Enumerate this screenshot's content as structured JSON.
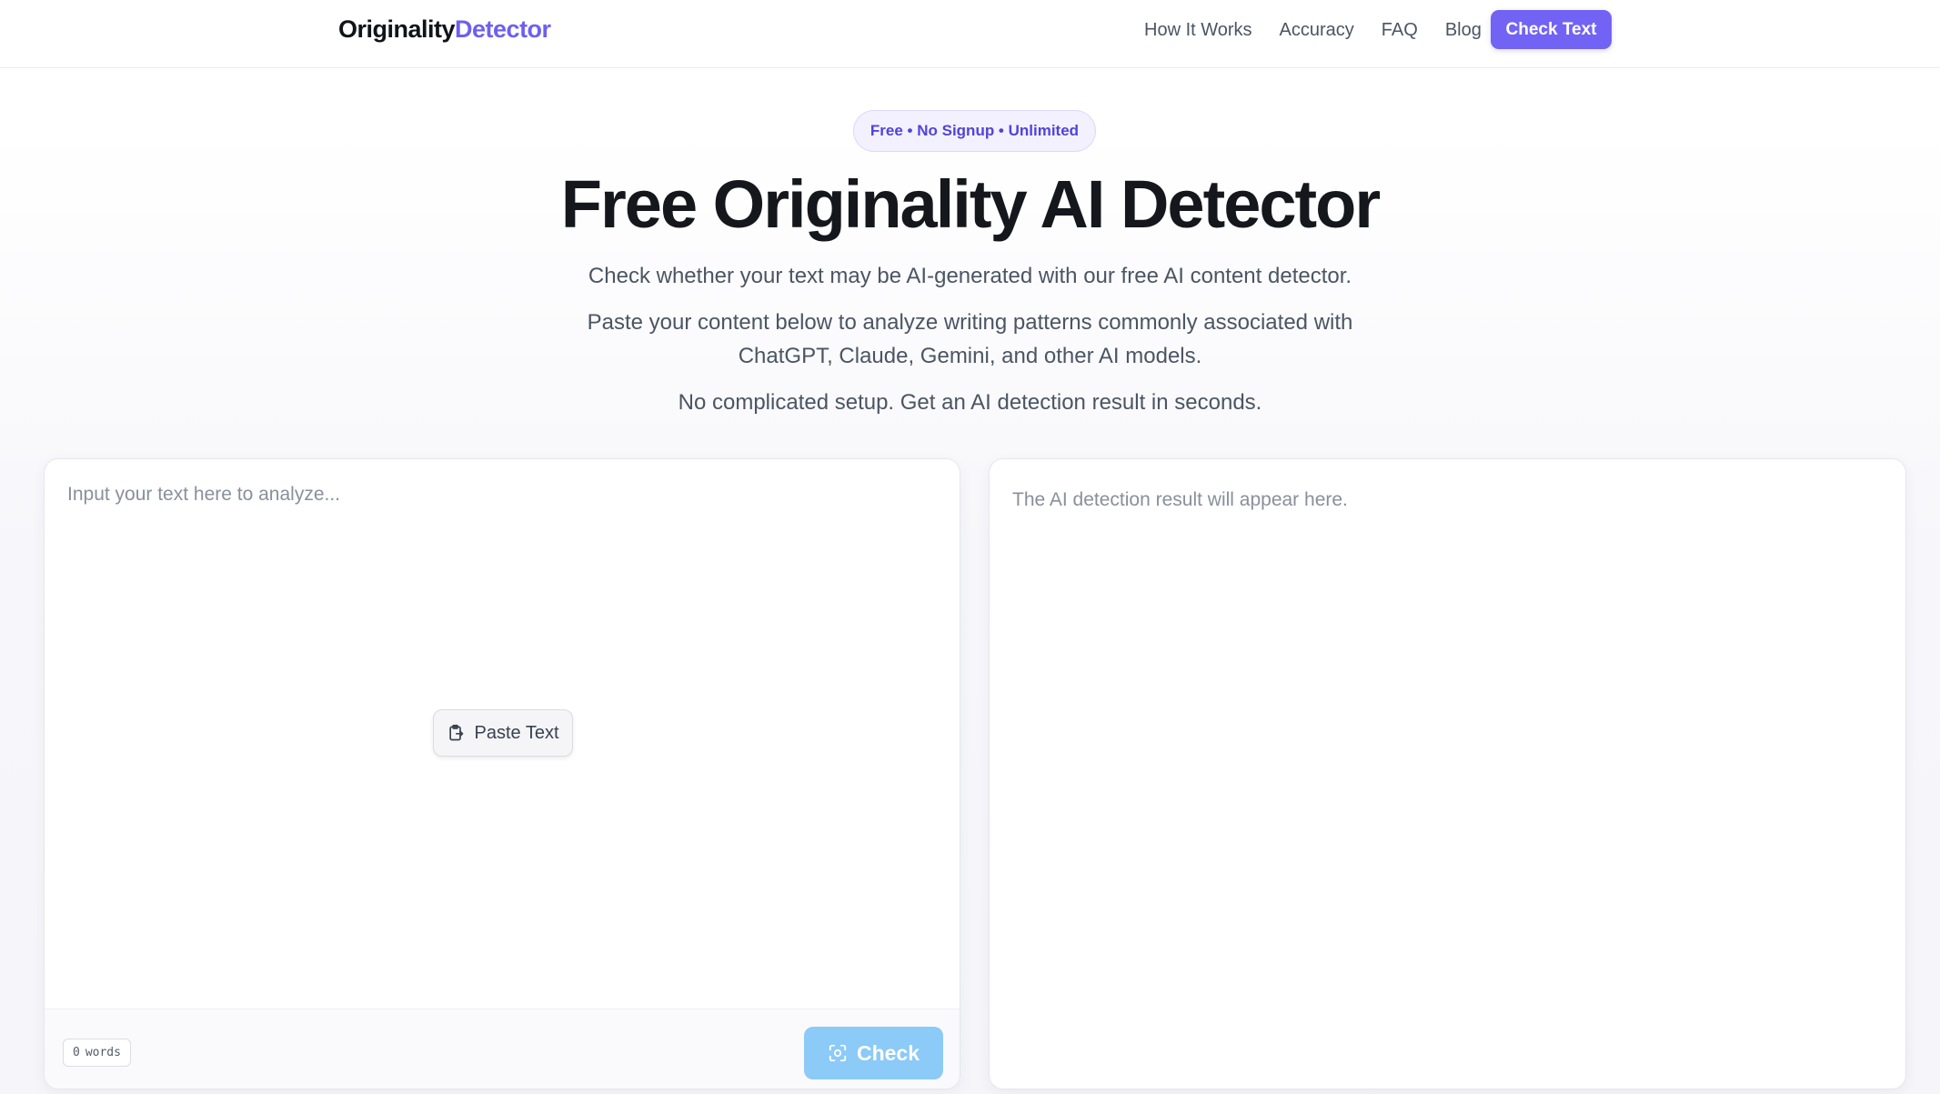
{
  "header": {
    "logo_part1": "Originality",
    "logo_part2": "Detector",
    "nav": [
      "How It Works",
      "Accuracy",
      "FAQ",
      "Blog"
    ],
    "cta_label": "Check Text"
  },
  "hero": {
    "badge": "Free • No Signup • Unlimited",
    "title": "Free Originality AI Detector",
    "line1": "Check whether your text may be AI-generated with our free AI content detector.",
    "line2": "Paste your content below to analyze writing patterns commonly associated with",
    "line3": "ChatGPT, Claude, Gemini, and other AI models.",
    "line4": "No complicated setup. Get an AI detection result in seconds."
  },
  "input_panel": {
    "placeholder": "Input your text here to analyze...",
    "paste_label": "Paste Text",
    "paste_icon": "clipboard-icon",
    "word_count": "0",
    "word_count_unit": "words",
    "check_label": "Check",
    "check_icon": "scan-icon"
  },
  "result_panel": {
    "placeholder": "The AI detection result will appear here."
  },
  "colors": {
    "brand": "#6d5ff2",
    "cta": "#7263f5",
    "check_button": "#8ccaf7",
    "badge_text": "#5143d9"
  }
}
